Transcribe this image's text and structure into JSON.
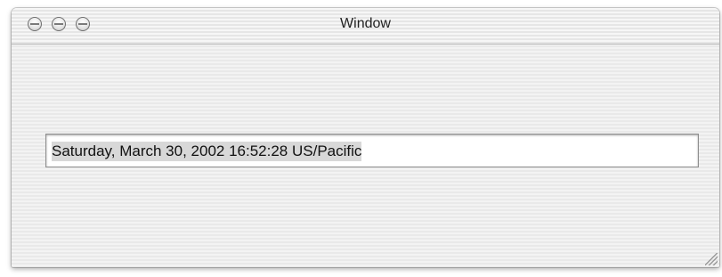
{
  "window": {
    "title": "Window",
    "controls": [
      "close-button",
      "minimize-button",
      "zoom-button"
    ]
  },
  "date_field": {
    "value": "Saturday, March 30, 2002 16:52:28 US/Pacific"
  }
}
